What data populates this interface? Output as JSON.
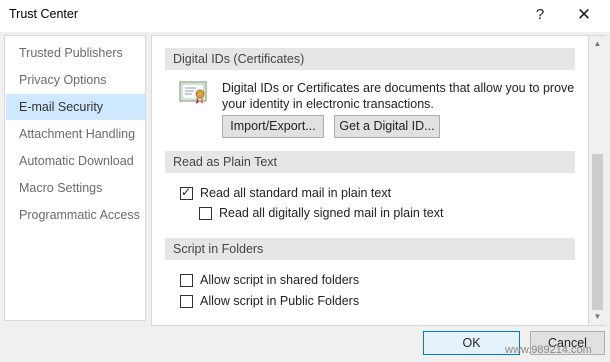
{
  "window": {
    "title": "Trust Center",
    "help_label": "?",
    "close_label": "✕"
  },
  "nav": {
    "items": [
      {
        "label": "Trusted Publishers",
        "selected": false
      },
      {
        "label": "Privacy Options",
        "selected": false
      },
      {
        "label": "E-mail Security",
        "selected": true
      },
      {
        "label": "Attachment Handling",
        "selected": false
      },
      {
        "label": "Automatic Download",
        "selected": false
      },
      {
        "label": "Macro Settings",
        "selected": false
      },
      {
        "label": "Programmatic Access",
        "selected": false
      }
    ]
  },
  "digital_ids": {
    "header": "Digital IDs (Certificates)",
    "description": "Digital IDs or Certificates are documents that allow you to prove your identity in electronic transactions.",
    "import_export_label": "Import/Export...",
    "get_id_label": "Get a Digital ID..."
  },
  "plain_text": {
    "header": "Read as Plain Text",
    "read_all_label": "Read all standard mail in plain text",
    "read_all_checked": true,
    "read_signed_label": "Read all digitally signed mail in plain text",
    "read_signed_checked": false
  },
  "script_folders": {
    "header": "Script in Folders",
    "shared_label": "Allow script in shared folders",
    "shared_checked": false,
    "public_label": "Allow script in Public Folders",
    "public_checked": false
  },
  "footer": {
    "ok_label": "OK",
    "cancel_label": "Cancel"
  },
  "watermark": "www.989214.com",
  "colors": {
    "selected_nav": "#cde8ff",
    "section_header": "#e6e6e6",
    "default_button_border": "#0078d7"
  }
}
